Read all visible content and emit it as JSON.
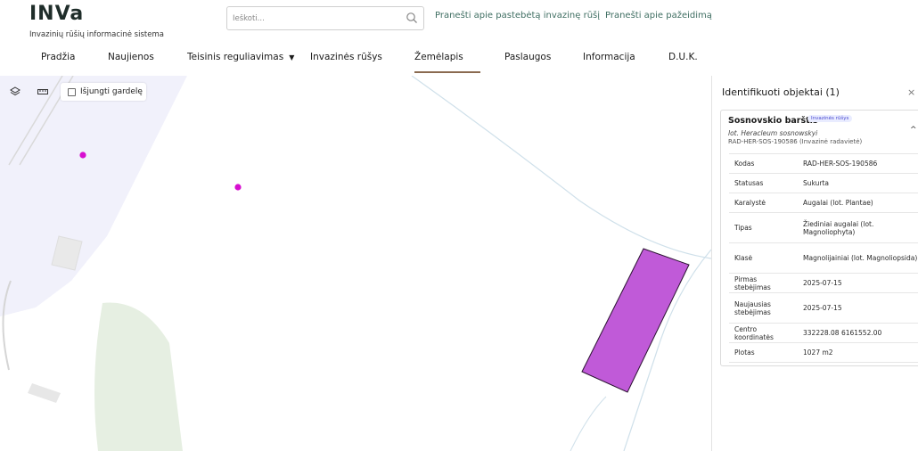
{
  "header": {
    "logo": "INVa",
    "subtitle": "Invazinių rūšių informacinė sistema",
    "search_placeholder": "Ieškoti...",
    "links": [
      "Pranešti apie pastebėtą invazinę rūšį",
      "Pranešti apie pažeidimą"
    ]
  },
  "nav": {
    "items": [
      {
        "label": "Pradžia"
      },
      {
        "label": "Naujienos"
      },
      {
        "label": "Teisinis reguliavimas"
      },
      {
        "label": "Invazinės rūšys"
      },
      {
        "label": "Žemėlapis",
        "active": true
      },
      {
        "label": "Paslaugos"
      },
      {
        "label": "Informacija"
      },
      {
        "label": "D.U.K."
      }
    ]
  },
  "map": {
    "grid_toggle_label": "Išjungti gardelę",
    "grid_toggle_checked": false,
    "colors": {
      "zone_fill": "#f1f1fb",
      "building": "#e8e8e8",
      "green": "#e6efe2",
      "road": "#cfe0ea",
      "point": "#d70fd0",
      "polygon": "#c05ad8"
    }
  },
  "panel": {
    "title": "Identifikuoti objektai (1)",
    "close_symbol": "×",
    "card": {
      "name": "Sosnovskio barštis",
      "badge": "Invazinės rūšys",
      "latin": "lot. Heracleum sosnowskyi",
      "code": "RAD-HER-SOS-190586 (Invazinė radavietė)",
      "attributes": [
        {
          "key": "Kodas",
          "value": "RAD-HER-SOS-190586"
        },
        {
          "key": "Statusas",
          "value": "Sukurta"
        },
        {
          "key": "Karalystė",
          "value": "Augalai (lot. Plantae)"
        },
        {
          "key": "Tipas",
          "value": "Žiediniai augalai (lot. Magnoliophyta)"
        },
        {
          "key": "Klasė",
          "value": "Magnolijainiai (lot. Magnoliopsida)"
        },
        {
          "key": "Pirmas stebėjimas",
          "value": "2025-07-15"
        },
        {
          "key": "Naujausias stebėjimas",
          "value": "2025-07-15"
        },
        {
          "key": "Centro koordinatės",
          "value": "332228.08 6161552.00"
        },
        {
          "key": "Plotas",
          "value": "1027 m2"
        }
      ]
    }
  }
}
